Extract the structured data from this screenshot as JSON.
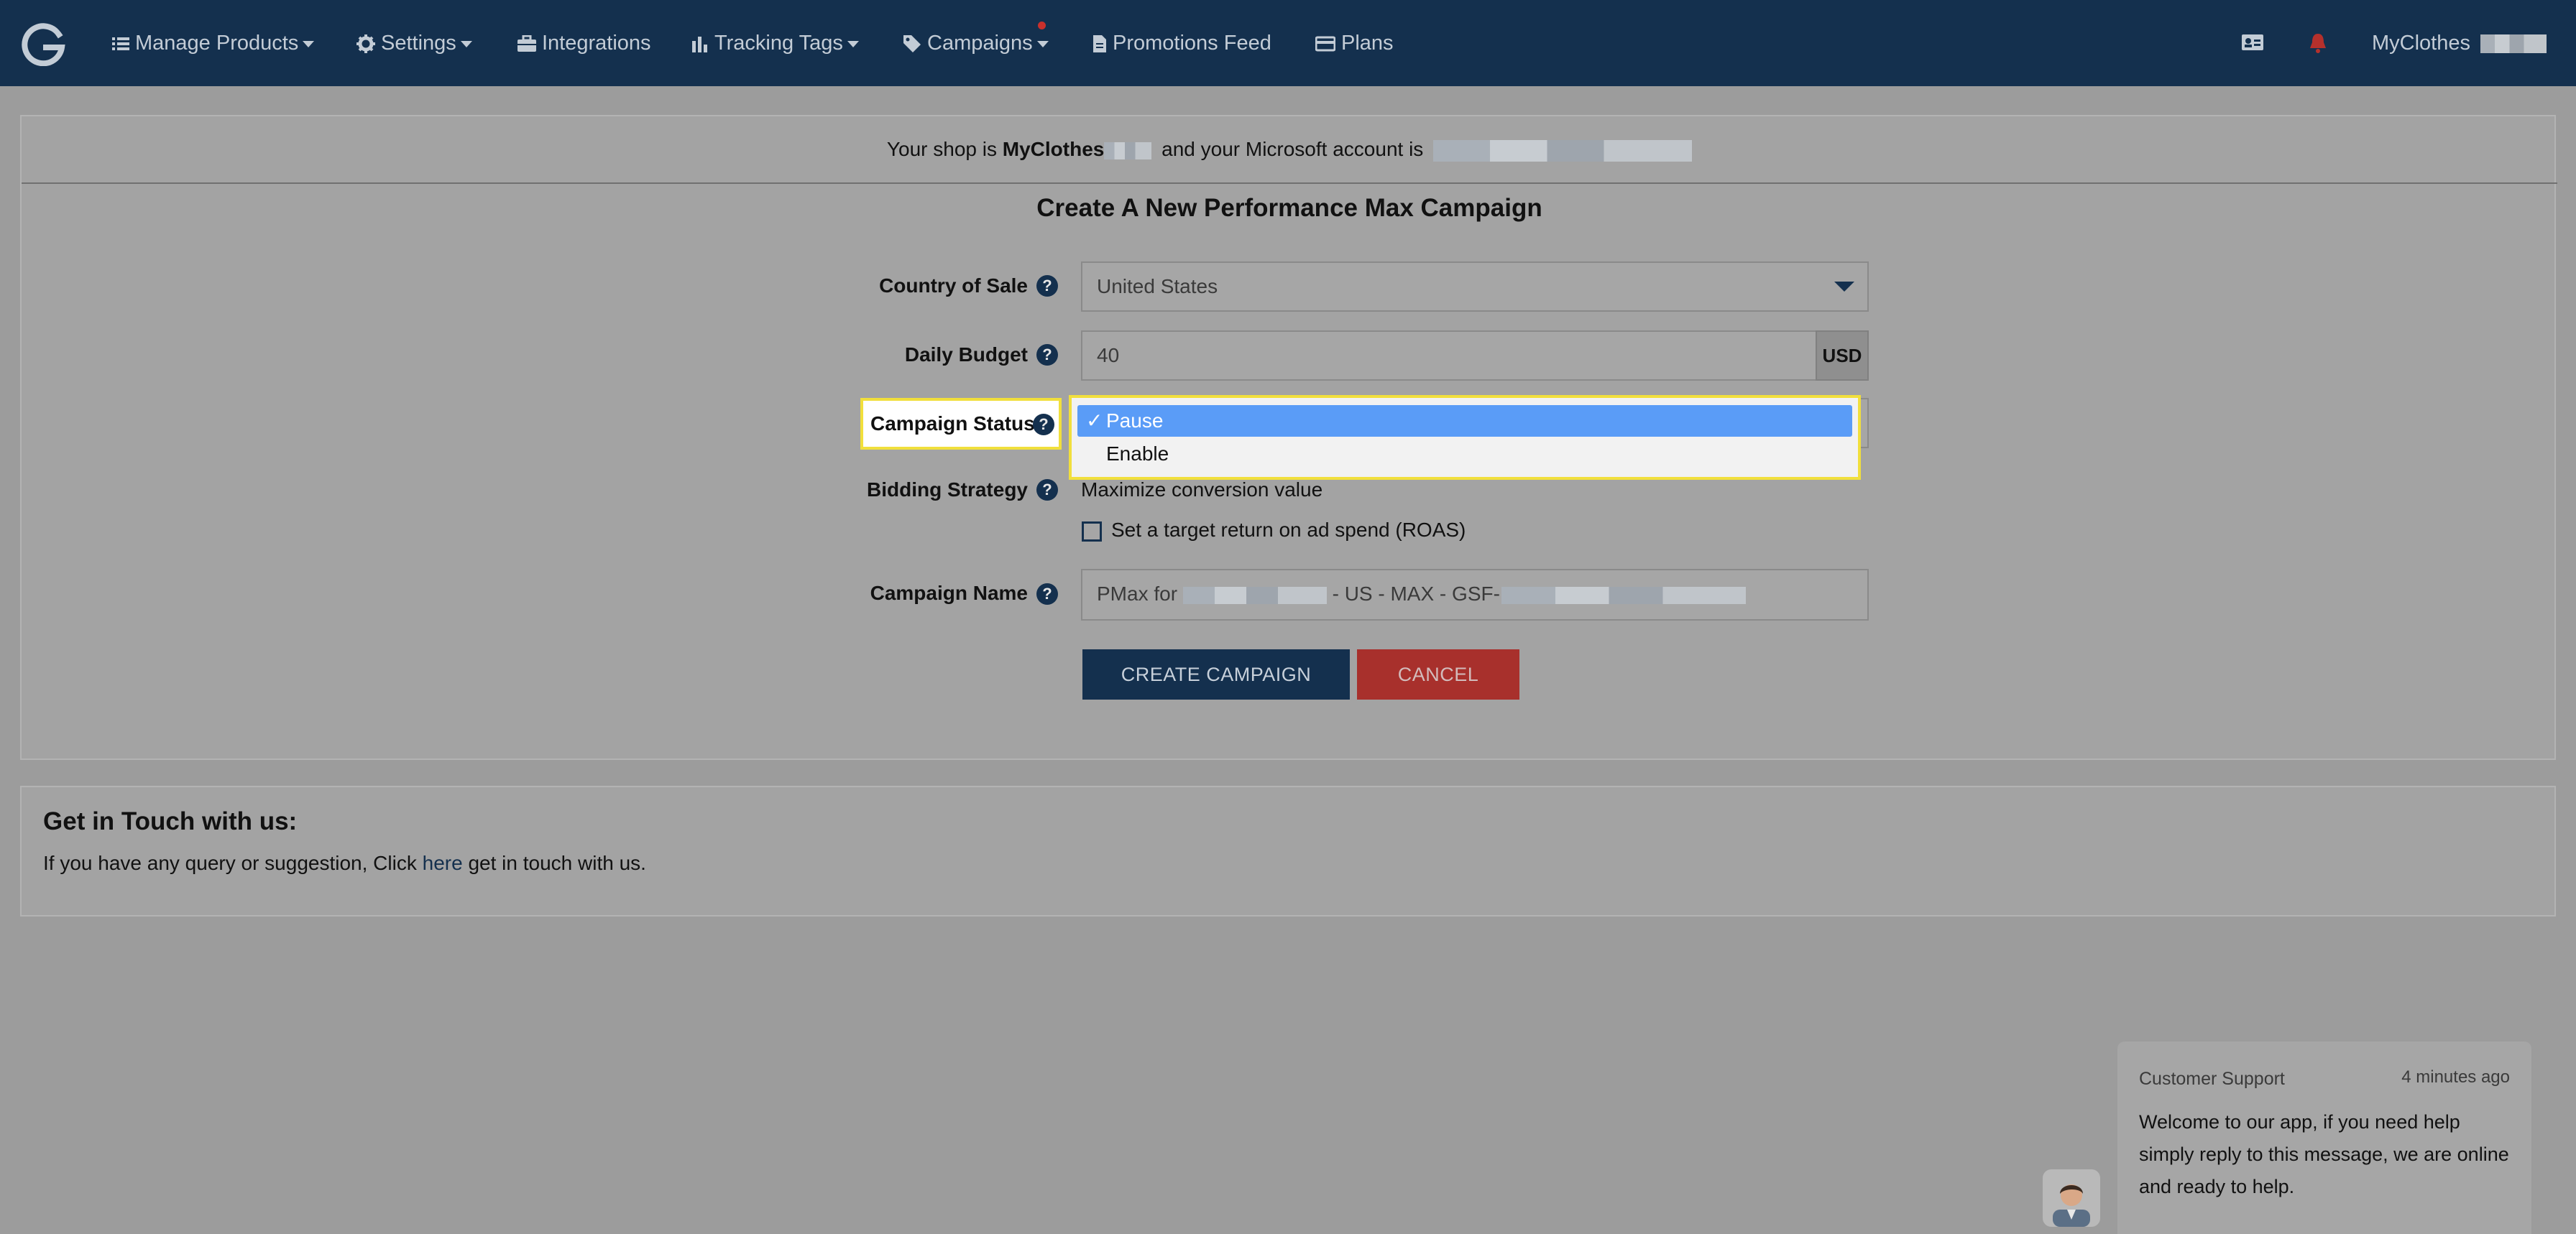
{
  "navbar": {
    "logo_letter": "G",
    "items": [
      {
        "label": "Manage Products",
        "icon": "list-icon",
        "has_caret": true
      },
      {
        "label": "Settings",
        "icon": "gear-icon",
        "has_caret": true
      },
      {
        "label": "Integrations",
        "icon": "briefcase-icon",
        "has_caret": false
      },
      {
        "label": "Tracking Tags",
        "icon": "bar-chart-icon",
        "has_caret": true
      },
      {
        "label": "Campaigns",
        "icon": "tag-icon",
        "has_caret": true,
        "notification_dot": true
      },
      {
        "label": "Promotions Feed",
        "icon": "document-icon",
        "has_caret": false
      },
      {
        "label": "Plans",
        "icon": "credit-card-icon",
        "has_caret": false
      }
    ],
    "right": {
      "contact_card_icon": "contact-card-icon",
      "bell_icon": "bell-icon",
      "account_label": "MyClothes"
    }
  },
  "shop_bar": {
    "prefix": "Your shop is",
    "shop_name": "MyClothes",
    "middle": "and your Microsoft account is"
  },
  "form": {
    "title": "Create A New Performance Max Campaign",
    "country_label": "Country of Sale",
    "country_value": "United States",
    "budget_label": "Daily Budget",
    "budget_value": "40",
    "budget_currency": "USD",
    "status_label": "Campaign Status",
    "status_options": [
      "Pause",
      "Enable"
    ],
    "status_selected": "Pause",
    "bidding_label": "Bidding Strategy",
    "bidding_value": "Maximize conversion value",
    "roas_checkbox_label": "Set a target return on ad spend (ROAS)",
    "roas_checked": false,
    "campaign_name_label": "Campaign Name",
    "campaign_name_prefix": "PMax for",
    "campaign_name_middle": "- US - MAX - GSF-",
    "create_button": "CREATE CAMPAIGN",
    "cancel_button": "CANCEL",
    "help_glyph": "?"
  },
  "get_in_touch": {
    "title": "Get in Touch with us:",
    "text_before": "If you have any query or suggestion, Click",
    "link": "here",
    "text_after": "get in touch with us."
  },
  "chat": {
    "from": "Customer Support",
    "time": "4 minutes ago",
    "message": "Welcome to our app, if you need help simply reply to this message, we are online and ready to help."
  },
  "colors": {
    "navbar": "#14304e",
    "primary": "#14304e",
    "danger": "#a8302c",
    "highlight": "#f1df3c",
    "selected_option": "#5a9cf7"
  }
}
